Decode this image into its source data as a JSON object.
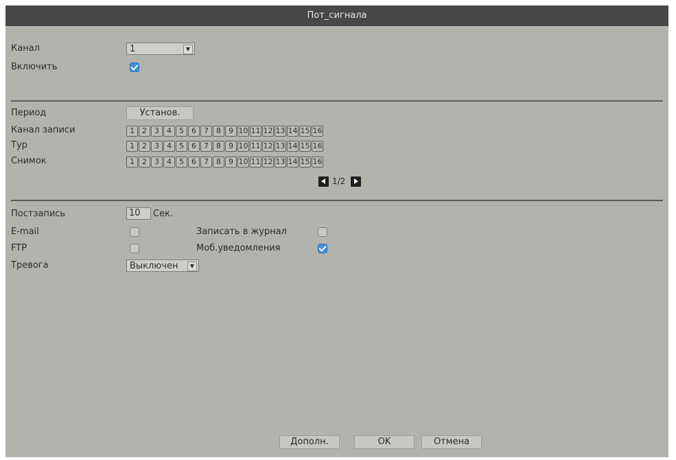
{
  "window": {
    "title": "Пот_сигнала"
  },
  "channel": {
    "label": "Канал",
    "value": "1"
  },
  "enable": {
    "label": "Включить",
    "checked": true
  },
  "period": {
    "label": "Период",
    "button": "Установ."
  },
  "record_channel": {
    "label": "Канал записи"
  },
  "tour": {
    "label": "Тур"
  },
  "snapshot": {
    "label": "Снимок"
  },
  "channel_numbers": [
    "1",
    "2",
    "3",
    "4",
    "5",
    "6",
    "7",
    "8",
    "9",
    "10",
    "11",
    "12",
    "13",
    "14",
    "15",
    "16"
  ],
  "pager": {
    "text": "1/2"
  },
  "post_record": {
    "label": "Постзапись",
    "value": "10",
    "unit": "Сек."
  },
  "email": {
    "label": "E-mail",
    "checked": false
  },
  "write_log": {
    "label": "Записать в журнал",
    "checked": false
  },
  "ftp": {
    "label": "FTP",
    "checked": false
  },
  "mobile_notify": {
    "label": "Моб.уведомления",
    "checked": true
  },
  "alarm": {
    "label": "Тревога",
    "value": "Выключен"
  },
  "footer": {
    "advanced": "Дополн.",
    "ok": "OK",
    "cancel": "Отмена"
  },
  "colors": {
    "titlebar": "#464849",
    "background": "#b3b3ad",
    "checkbox_on": "#3f8fd8"
  }
}
